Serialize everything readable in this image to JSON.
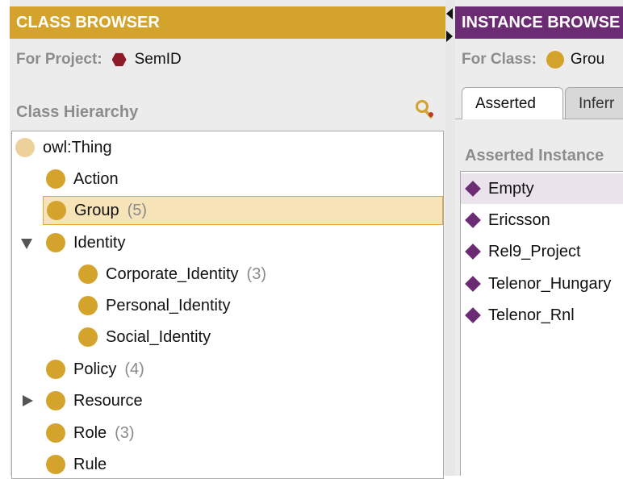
{
  "class_browser": {
    "title": "CLASS BROWSER",
    "for_project_label": "For Project:",
    "project_name": "SemID",
    "hierarchy_label": "Class Hierarchy",
    "tree": [
      {
        "label": "owl:Thing",
        "count": ""
      },
      {
        "label": "Action",
        "count": ""
      },
      {
        "label": "Group",
        "count": "(5)",
        "selected": true
      },
      {
        "label": "Identity",
        "count": "",
        "expanded": true
      },
      {
        "label": "Corporate_Identity",
        "count": "(3)"
      },
      {
        "label": "Personal_Identity",
        "count": ""
      },
      {
        "label": "Social_Identity",
        "count": ""
      },
      {
        "label": "Policy",
        "count": "(4)"
      },
      {
        "label": "Resource",
        "count": "",
        "collapsed": true
      },
      {
        "label": "Role",
        "count": "(3)"
      },
      {
        "label": "Rule",
        "count": ""
      }
    ]
  },
  "instance_browser": {
    "title": "INSTANCE BROWSE",
    "for_class_label": "For Class:",
    "class_name": "Grou",
    "tabs": [
      "Asserted",
      "Inferr"
    ],
    "asserted_label": "Asserted Instance",
    "instances": [
      "Empty",
      "Ericsson",
      "Rel9_Project",
      "Telenor_Hungary",
      "Telenor_Rnl"
    ]
  },
  "colors": {
    "class_accent": "#d4a32c",
    "instance_accent": "#6b2c73",
    "project_icon": "#8e1b2a",
    "selection_bg": "#f6e4b8"
  },
  "icons": {
    "project": "hexagon-icon",
    "class": "class-dot-icon",
    "instance": "instance-diamond-icon",
    "search": "find-class-icon"
  }
}
